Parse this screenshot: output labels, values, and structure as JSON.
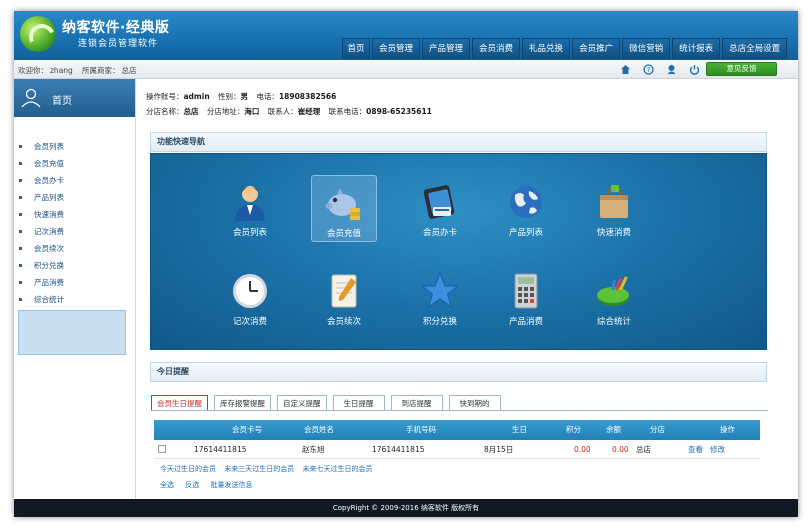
{
  "brand": {
    "title": "纳客软件·经典版",
    "subtitle": "连锁会员管理软件"
  },
  "nav": [
    {
      "label": "首页"
    },
    {
      "label": "会员管理"
    },
    {
      "label": "产品管理"
    },
    {
      "label": "会员消费"
    },
    {
      "label": "礼品兑换"
    },
    {
      "label": "会员推广"
    },
    {
      "label": "微信营销"
    },
    {
      "label": "统计报表"
    },
    {
      "label": "总店全局设置"
    }
  ],
  "subbar": {
    "welcome_label": "欢迎你：",
    "user": "zhang",
    "store_label": "所属商家：",
    "store": "总店",
    "feedback": "意见反馈"
  },
  "sidebar": {
    "home": "首页",
    "items": [
      {
        "label": "会员列表"
      },
      {
        "label": "会员充值"
      },
      {
        "label": "会员办卡"
      },
      {
        "label": "产品列表"
      },
      {
        "label": "快速消费"
      },
      {
        "label": "记次消费"
      },
      {
        "label": "会员续次"
      },
      {
        "label": "积分兑换"
      },
      {
        "label": "产品消费"
      },
      {
        "label": "综合统计"
      }
    ]
  },
  "info": {
    "operator_label": "操作账号：",
    "operator": "admin",
    "gender_label": "性别：",
    "gender": "男",
    "phone_label": "电话：",
    "phone": "18908382566",
    "branch_label": "分店名称：",
    "branch": "总店",
    "address_label": "分店地址：",
    "address": "海口",
    "contact_label": "联系人：",
    "contact": "崔经理",
    "contact_phone_label": "联系电话：",
    "contact_phone": "0898-65235611"
  },
  "quick_nav": {
    "title": "功能快速导航",
    "items": [
      {
        "label": "会员列表",
        "icon": "user-icon"
      },
      {
        "label": "会员充值",
        "icon": "piggy-bank-icon"
      },
      {
        "label": "会员办卡",
        "icon": "card-icon"
      },
      {
        "label": "产品列表",
        "icon": "globe-icon"
      },
      {
        "label": "快速消费",
        "icon": "shopping-bag-icon"
      },
      {
        "label": "记次消费",
        "icon": "clock-icon"
      },
      {
        "label": "会员续次",
        "icon": "notepad-icon"
      },
      {
        "label": "积分兑换",
        "icon": "star-icon"
      },
      {
        "label": "产品消费",
        "icon": "calculator-icon"
      },
      {
        "label": "综合统计",
        "icon": "pie-chart-icon"
      }
    ]
  },
  "reminder": {
    "title": "今日提醒",
    "tabs": [
      {
        "label": "会员生日提醒"
      },
      {
        "label": "库存报警提醒"
      },
      {
        "label": "自定义提醒"
      },
      {
        "label": "生日提醒"
      },
      {
        "label": "到店提醒"
      },
      {
        "label": "快到期的"
      }
    ],
    "columns": [
      "会员卡号",
      "会员姓名",
      "手机号码",
      "生日",
      "积分",
      "余额",
      "分店",
      "操作"
    ],
    "row": {
      "card": "17614411815",
      "name": "赵东旭",
      "phone": "17614411815",
      "birthday": "8月15日",
      "points": "0.00",
      "balance": "0.00",
      "branch": "总店",
      "view": "查看",
      "edit": "修改"
    },
    "filters": [
      "今天过生日的会员",
      "未来三天过生日的会员",
      "未来七天过生日的会员"
    ],
    "actions": [
      "全选",
      "反选",
      "批量发送信息"
    ]
  },
  "footer": "CopyRight © 2009-2016 纳客软件 版权所有",
  "colors": {
    "header": "#1973b3",
    "accent": "#2181b8",
    "green": "#2f8f21",
    "alert": "#d32020"
  }
}
